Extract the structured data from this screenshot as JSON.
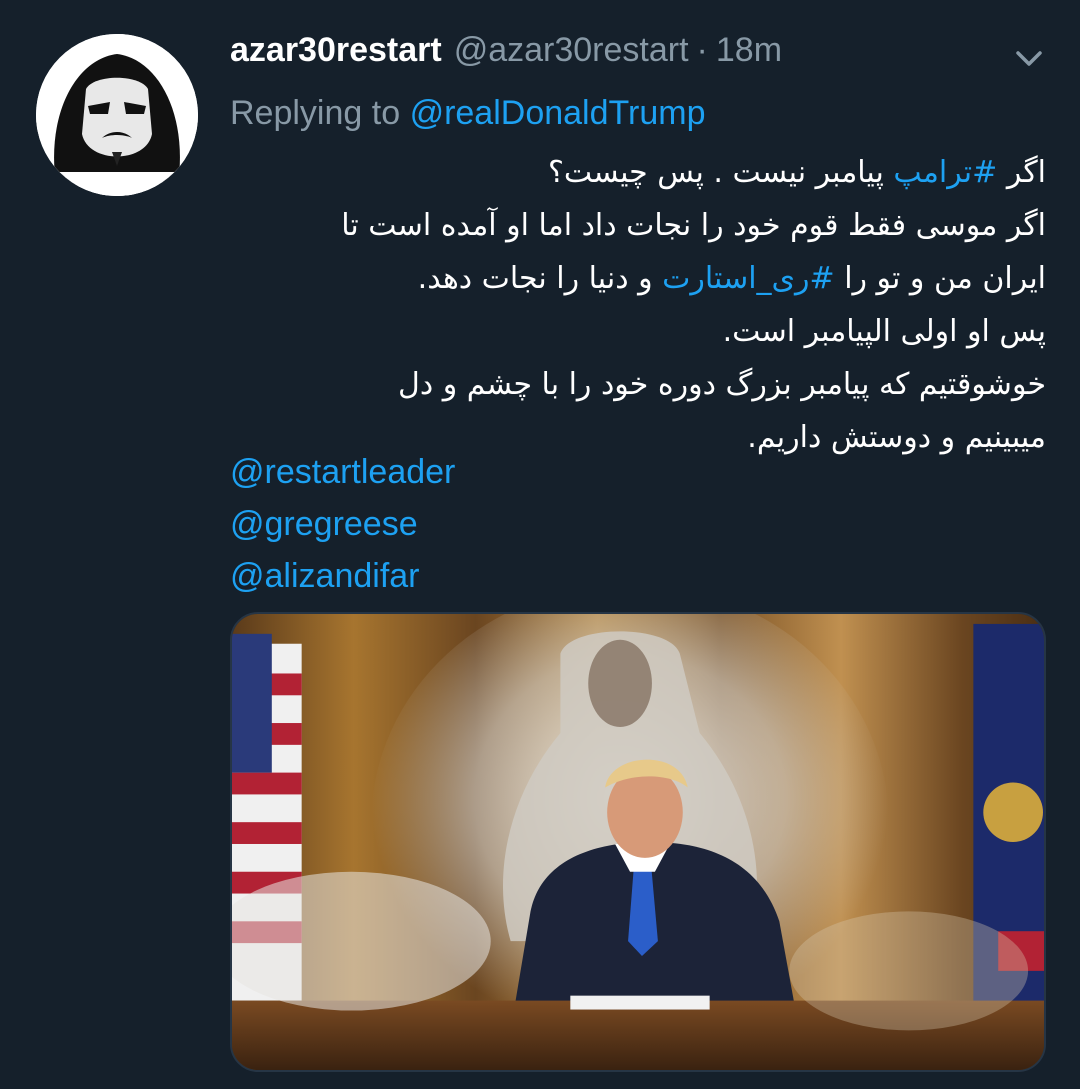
{
  "author": {
    "display_name": "azar30restart",
    "handle": "@azar30restart",
    "separator": "·",
    "time": "18m"
  },
  "reply": {
    "prefix": "Replying to",
    "to": "@realDonaldTrump"
  },
  "body": {
    "line1": {
      "start": "اگر",
      "hashtag": "#ترامپ",
      "end": "پیامبر نیست . پس چیست؟"
    },
    "line2": "اگر موسی فقط قوم خود را نجات داد اما او آمده است تا",
    "line3": {
      "start": "ایران من و تو را",
      "hashtag": "#ری_استارت",
      "end": "و دنیا را نجات دهد."
    },
    "line4": "پس او اولی الپیامبر است.",
    "line5": "خوشوقتیم که پیامبر بزرگ دوره خود را با چشم و دل",
    "line6": "میبینیم و دوستش داریم."
  },
  "mentions": [
    "@restartleader",
    "@gregreese",
    "@alizandifar"
  ],
  "colors": {
    "background": "#15202b",
    "primary_text": "#ffffff",
    "secondary_text": "#8899a6",
    "link": "#1da1f2"
  },
  "icons": {
    "avatar": "masked-face-avatar",
    "menu": "chevron-down-icon"
  }
}
